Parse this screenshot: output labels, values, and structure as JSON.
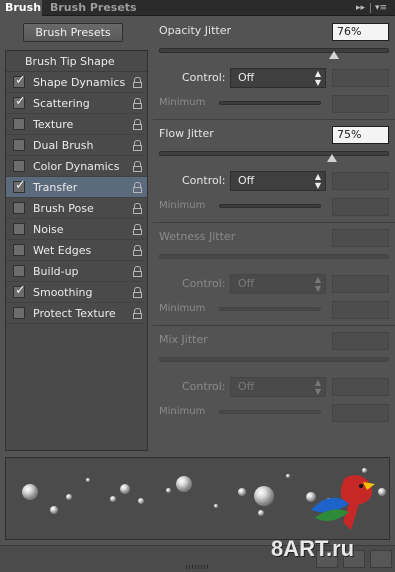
{
  "tabs": [
    {
      "label": "Brush",
      "active": true
    },
    {
      "label": "Brush Presets",
      "active": false
    }
  ],
  "tabbar_icons": [
    "collapse-icon",
    "panel-menu-icon"
  ],
  "presets_button": "Brush Presets",
  "options": {
    "header": "Brush Tip Shape",
    "items": [
      {
        "label": "Shape Dynamics",
        "checked": true,
        "selected": false
      },
      {
        "label": "Scattering",
        "checked": true,
        "selected": false
      },
      {
        "label": "Texture",
        "checked": false,
        "selected": false
      },
      {
        "label": "Dual Brush",
        "checked": false,
        "selected": false
      },
      {
        "label": "Color Dynamics",
        "checked": false,
        "selected": false
      },
      {
        "label": "Transfer",
        "checked": true,
        "selected": true
      },
      {
        "label": "Brush Pose",
        "checked": false,
        "selected": false
      },
      {
        "label": "Noise",
        "checked": false,
        "selected": false
      },
      {
        "label": "Wet Edges",
        "checked": false,
        "selected": false
      },
      {
        "label": "Build-up",
        "checked": false,
        "selected": false
      },
      {
        "label": "Smoothing",
        "checked": true,
        "selected": false
      },
      {
        "label": "Protect Texture",
        "checked": false,
        "selected": false
      }
    ]
  },
  "sections": [
    {
      "title": "Opacity Jitter",
      "value": "76%",
      "slider": 0.76,
      "enabled": true,
      "control_label": "Control:",
      "control_value": "Off",
      "minimum_label": "Minimum"
    },
    {
      "title": "Flow Jitter",
      "value": "75%",
      "slider": 0.75,
      "enabled": true,
      "control_label": "Control:",
      "control_value": "Off",
      "minimum_label": "Minimum"
    },
    {
      "title": "Wetness Jitter",
      "value": "",
      "slider": null,
      "enabled": false,
      "control_label": "Control:",
      "control_value": "Off",
      "minimum_label": "Minimum"
    },
    {
      "title": "Mix Jitter",
      "value": "",
      "slider": null,
      "enabled": false,
      "control_label": "Control:",
      "control_value": "Off",
      "minimum_label": "Minimum"
    }
  ],
  "watermark": "8ART.ru",
  "colors": {
    "panel": "#535353",
    "selected_row": "#5b6b7d",
    "tab_bar": "#2b2b2b"
  }
}
